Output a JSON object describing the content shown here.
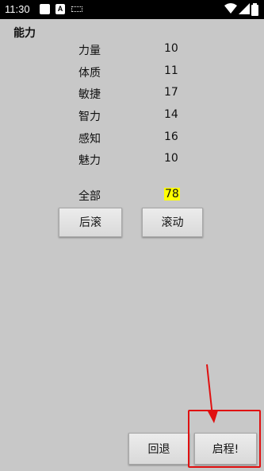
{
  "status_bar": {
    "time": "11:30",
    "notification_b": "A",
    "icons": [
      "notification-icon",
      "app-icon",
      "keyboard-icon",
      "wifi-icon",
      "signal-icon",
      "battery-icon"
    ]
  },
  "section_title": "能力",
  "stats": [
    {
      "label": "力量",
      "value": "10"
    },
    {
      "label": "体质",
      "value": "11"
    },
    {
      "label": "敏捷",
      "value": "17"
    },
    {
      "label": "智力",
      "value": "14"
    },
    {
      "label": "感知",
      "value": "16"
    },
    {
      "label": "魅力",
      "value": "10"
    }
  ],
  "total": {
    "label": "全部",
    "value": "78",
    "highlight_color": "#ffff00"
  },
  "buttons": {
    "back_roll": "后滚",
    "roll": "滚动",
    "go_back": "回退",
    "start": "启程!"
  },
  "annotation_color": "#e01010"
}
